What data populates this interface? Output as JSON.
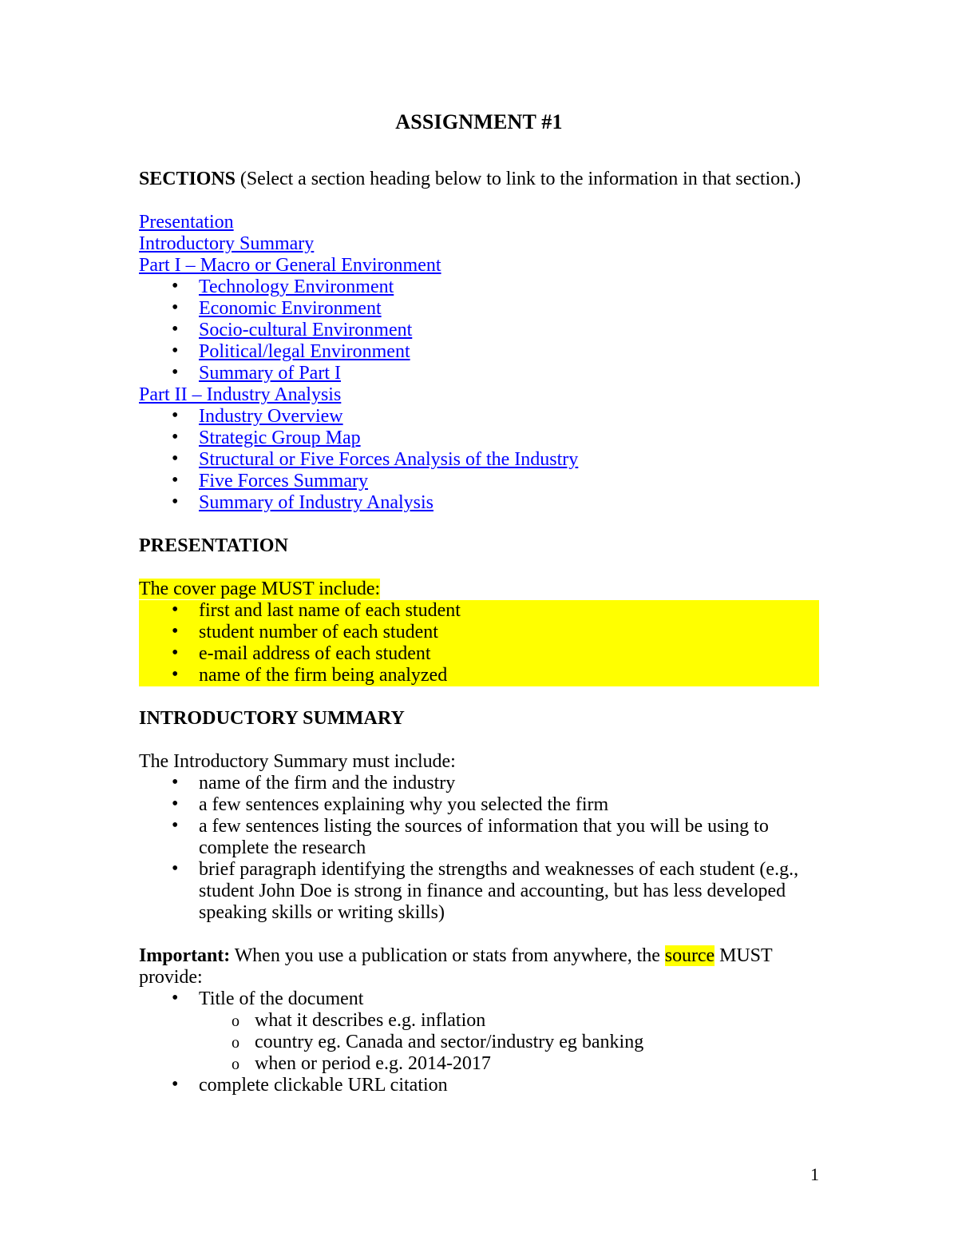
{
  "document": {
    "title": "ASSIGNMENT #1",
    "page_number": "1",
    "link_color": "#0000FF",
    "highlight_color": "#FFFF00"
  },
  "sections_block": {
    "label": "SECTIONS",
    "instruction": " (Select a section heading below to link to the information in that section.)",
    "links": [
      {
        "label": "Presentation",
        "level": "top"
      },
      {
        "label": "Introductory Summary",
        "level": "top"
      },
      {
        "label": "Part I – Macro or General Environment",
        "level": "top"
      },
      {
        "label": "Technology Environment",
        "level": "bullet"
      },
      {
        "label": "Economic Environment",
        "level": "bullet"
      },
      {
        "label": "Socio-cultural Environment",
        "level": "bullet"
      },
      {
        "label": "Political/legal Environment",
        "level": "bullet"
      },
      {
        "label": "Summary of Part I",
        "level": "bullet"
      },
      {
        "label": "Part II – Industry Analysis",
        "level": "top"
      },
      {
        "label": "Industry Overview",
        "level": "bullet"
      },
      {
        "label": "Strategic Group Map",
        "level": "bullet"
      },
      {
        "label": "Structural or Five Forces Analysis of the Industry",
        "level": "bullet"
      },
      {
        "label": "Five Forces Summary",
        "level": "bullet"
      },
      {
        "label": "Summary of Industry Analysis",
        "level": "bullet"
      }
    ]
  },
  "presentation": {
    "heading": "PRESENTATION",
    "intro": "The cover page MUST include:",
    "items": [
      "first and last name of each student",
      "student number of each student",
      "e-mail address of each student",
      "name of the firm being analyzed"
    ]
  },
  "introductory_summary": {
    "heading": "INTRODUCTORY SUMMARY",
    "intro": "The Introductory Summary must include:",
    "items": [
      "name of the firm and the industry",
      "a few sentences explaining why you selected the firm",
      "a few sentences listing the sources of information that you will be using to complete the research",
      "brief paragraph identifying the strengths and weaknesses of each student (e.g., student John Doe is strong in finance and accounting, but has less developed speaking skills or writing skills)"
    ]
  },
  "important": {
    "label": "Important:",
    "text_before_highlight": " When you use a publication or stats from anywhere, the ",
    "highlighted_word": "source",
    "text_after_highlight": " MUST provide:",
    "items": [
      {
        "text": "Title of the document",
        "sub_items": [
          "what it describes e.g. inflation",
          "country eg. Canada and sector/industry eg banking",
          "when or period e.g. 2014-2017"
        ]
      },
      {
        "text": "complete clickable URL citation",
        "sub_items": []
      }
    ]
  }
}
